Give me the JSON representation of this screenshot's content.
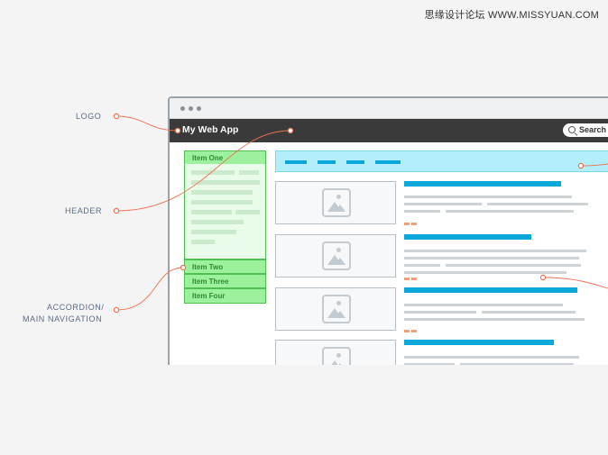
{
  "watermark": "思缘设计论坛 WWW.MISSYUAN.COM",
  "labels": {
    "logo": "LOGO",
    "header": "HEADER",
    "accordion_line1": "ACCORDION/",
    "accordion_line2": "MAIN NAVIGATION"
  },
  "app": {
    "title": "My Web App",
    "search_label": "Search"
  },
  "accordion": {
    "items": [
      "Item One",
      "Item Two",
      "Item Three",
      "Item Four"
    ]
  },
  "colors": {
    "header_bar": "#3a3a3a",
    "accordion_fill": "#9df09d",
    "accent_blue": "#0aa8d8",
    "annotation_line": "#f07050"
  },
  "icons": [
    "search-icon",
    "image-placeholder-icon"
  ]
}
